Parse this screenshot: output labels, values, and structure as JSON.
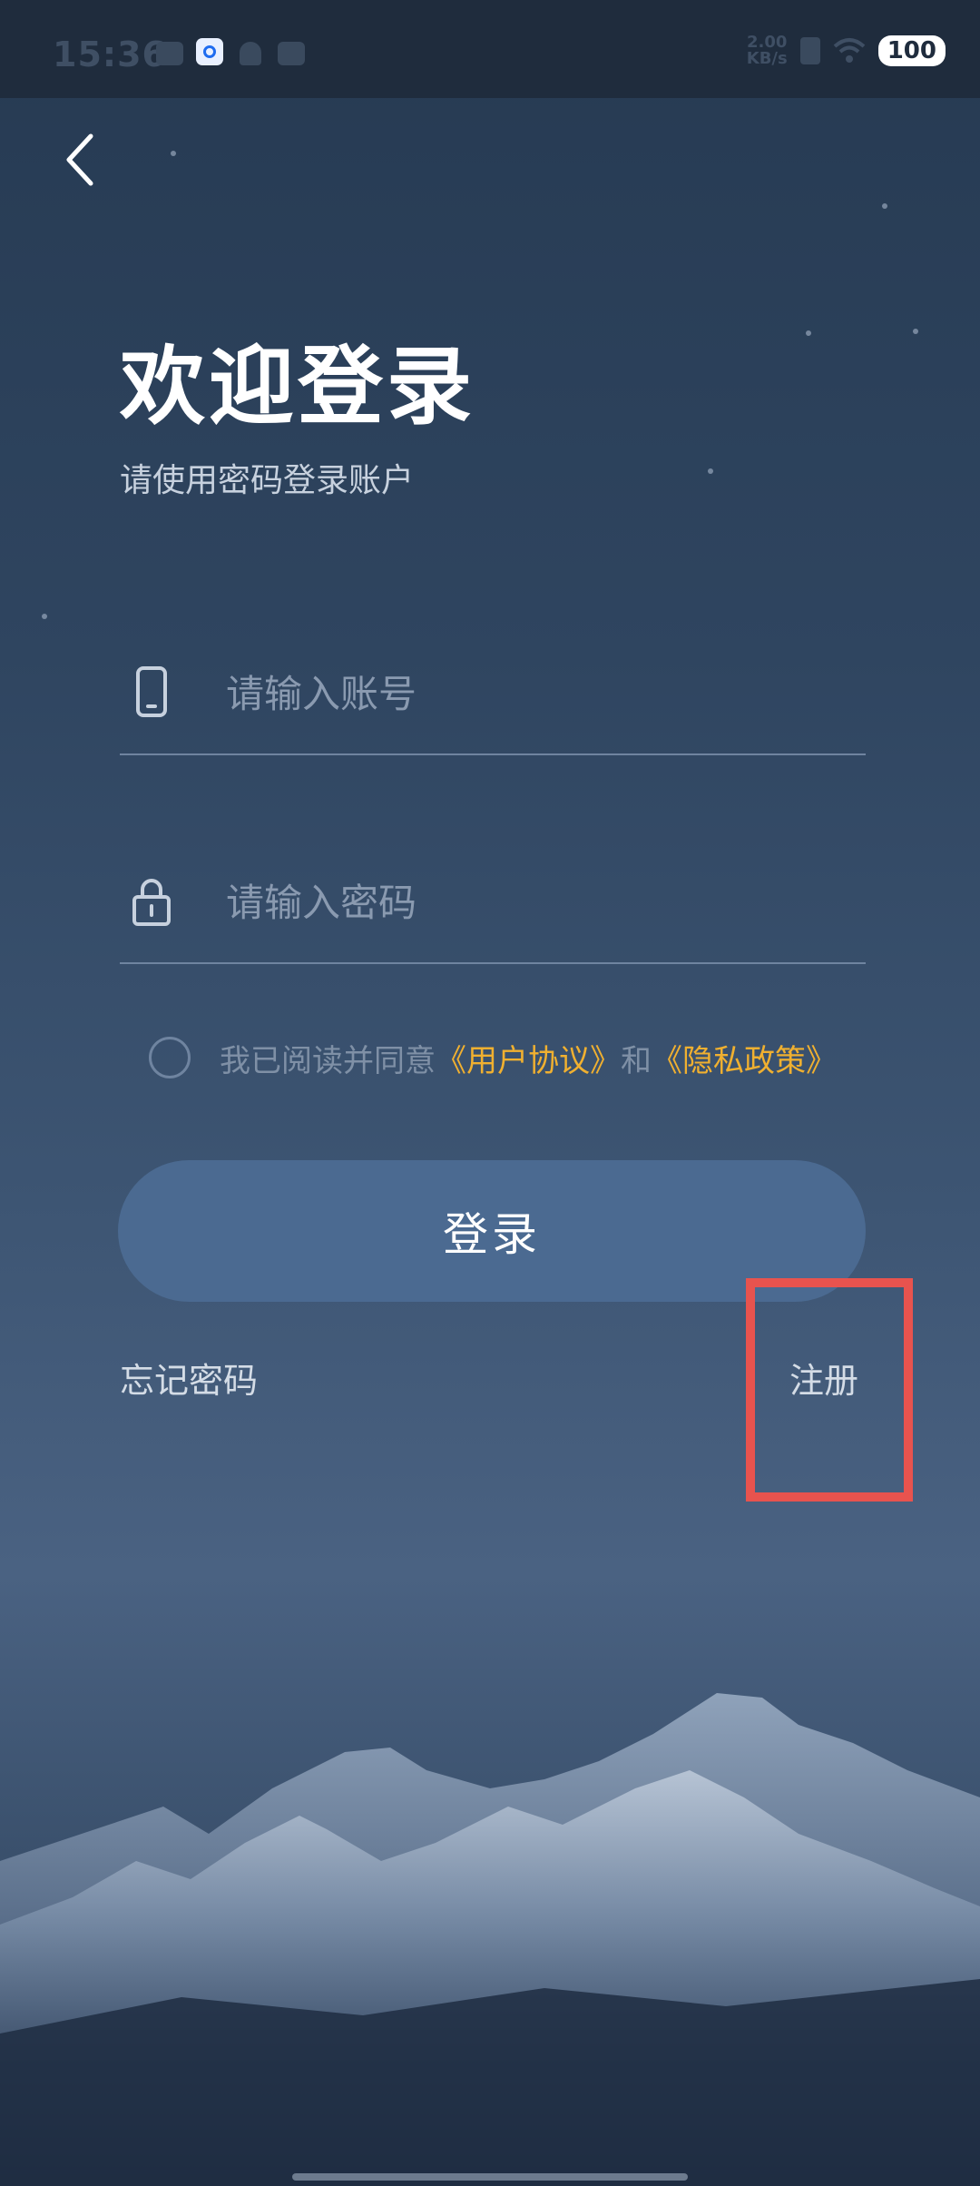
{
  "status_bar": {
    "time": "15:36",
    "speed_value": "2.00",
    "speed_unit": "KB/s",
    "battery": "100"
  },
  "header": {
    "back_icon": "chevron-left-icon"
  },
  "login": {
    "title": "欢迎登录",
    "subtitle": "请使用密码登录账户",
    "account_placeholder": "请输入账号",
    "account_icon": "phone-icon",
    "password_placeholder": "请输入密码",
    "password_icon": "lock-icon",
    "agree_prefix": "我已阅读并同意",
    "agree_user_agreement": "《用户协议》",
    "agree_and": "和",
    "agree_privacy_policy": "《隐私政策》",
    "login_button": "登录",
    "forgot_password": "忘记密码",
    "register": "注册"
  },
  "colors": {
    "accent_link": "#f0b030",
    "highlight_box": "#e8534e",
    "button_bg": "#4b6a91"
  }
}
